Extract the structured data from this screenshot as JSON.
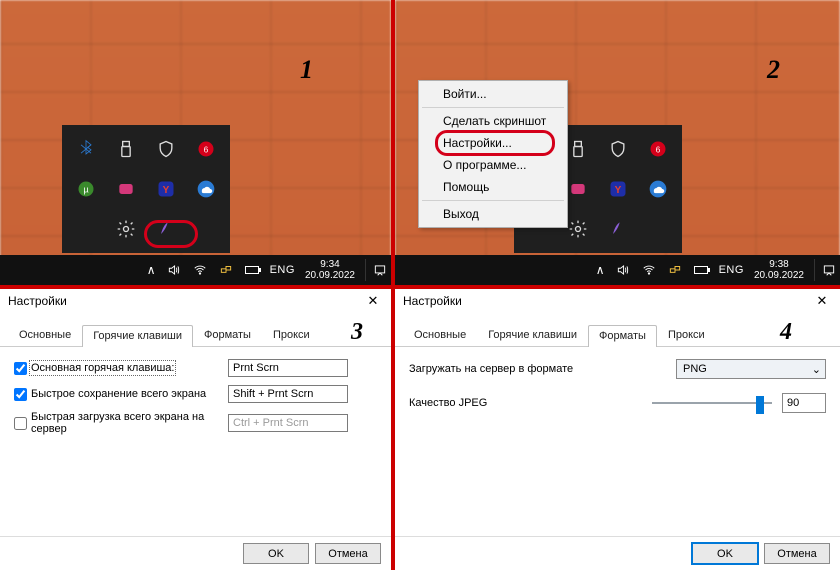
{
  "steps": {
    "s1": "1",
    "s2": "2",
    "s3": "3",
    "s4": "4"
  },
  "taskbar1": {
    "lang": "ENG",
    "time": "9:34",
    "date": "20.09.2022"
  },
  "taskbar2": {
    "lang": "ENG",
    "time": "9:38",
    "date": "20.09.2022"
  },
  "context_menu": {
    "login": "Войти...",
    "screenshot": "Сделать скриншот",
    "settings": "Настройки...",
    "about": "О программе...",
    "help": "Помощь",
    "exit": "Выход"
  },
  "dlg3": {
    "title": "Настройки",
    "tabs": {
      "general": "Основные",
      "hotkeys": "Горячие клавиши",
      "formats": "Форматы",
      "proxy": "Прокси"
    },
    "rows": {
      "main_hotkey_label": "Основная горячая клавиша:",
      "main_hotkey_value": "Prnt Scrn",
      "quick_save_label": "Быстрое сохранение всего экрана",
      "quick_save_value": "Shift + Prnt Scrn",
      "quick_upload_label": "Быстрая загрузка всего экрана на сервер",
      "quick_upload_value": "Ctrl + Prnt Scrn"
    },
    "ok": "OK",
    "cancel": "Отмена"
  },
  "dlg4": {
    "title": "Настройки",
    "tabs": {
      "general": "Основные",
      "hotkeys": "Горячие клавиши",
      "formats": "Форматы",
      "proxy": "Прокси"
    },
    "upload_format_label": "Загружать на сервер в формате",
    "upload_format_value": "PNG",
    "jpeg_quality_label": "Качество JPEG",
    "jpeg_quality_value": "90",
    "ok": "OK",
    "cancel": "Отмена"
  }
}
